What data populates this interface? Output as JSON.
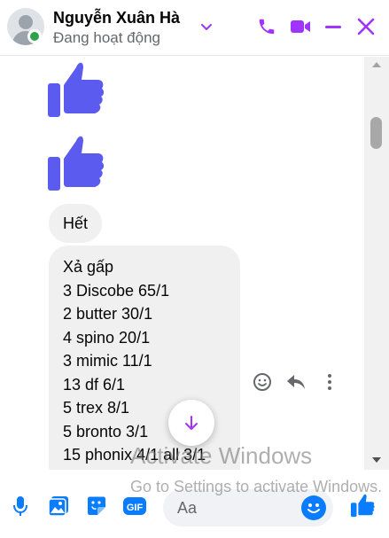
{
  "contact": {
    "name": "Nguyễn Xuân Hà",
    "status": "Đang hoạt động"
  },
  "colors": {
    "accent": "#a033ff",
    "messenger_blue": "#0a7cff",
    "like_blue": "#5b5bf0",
    "online_green": "#31a24c",
    "bubble_gray": "#f0f0f0"
  },
  "header_icons": [
    "chevron-down-icon",
    "phone-icon",
    "video-camera-icon",
    "minimize-icon",
    "close-icon"
  ],
  "messages": {
    "likes": 2,
    "short_message": "Hết",
    "list_message": [
      "Xả gấp",
      "3 Discobe 65/1",
      "2 butter 30/1",
      "4 spino 20/1",
      "3 mimic 11/1",
      "13 df 6/1",
      "5 trex 8/1",
      "5 bronto 3/1",
      "15 phonix 4/1 all 3/1"
    ],
    "actions": [
      "react-icon",
      "reply-icon",
      "more-icon"
    ]
  },
  "composer": {
    "placeholder": "Aa",
    "buttons": [
      "microphone-icon",
      "gallery-icon",
      "sticker-icon",
      "gif-icon"
    ],
    "gif_label": "GIF"
  },
  "watermark": {
    "title": "Activate Windows",
    "subtitle": "Go to Settings to activate Windows."
  }
}
